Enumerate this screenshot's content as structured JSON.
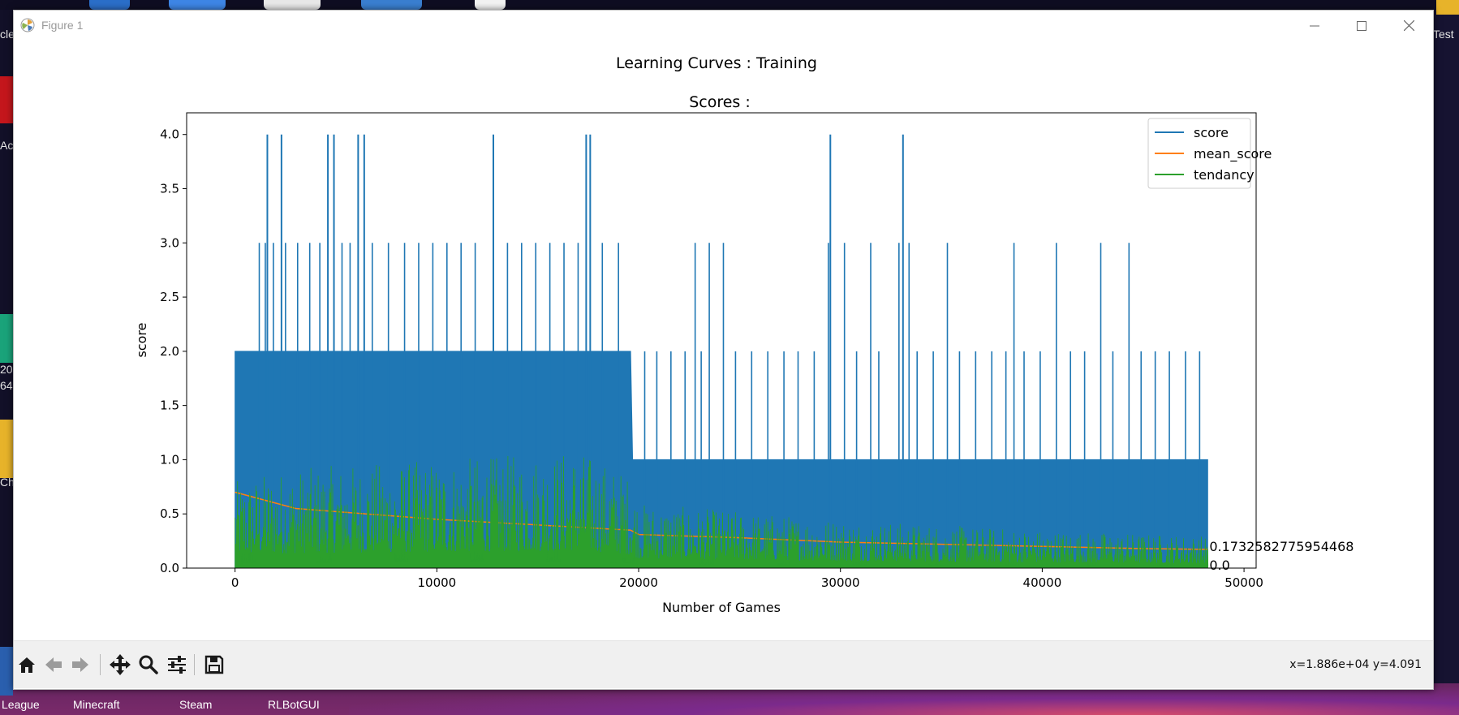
{
  "window": {
    "title": "Figure 1",
    "controls": {
      "minimize": "minimize",
      "maximize": "maximize",
      "close": "close"
    }
  },
  "figure": {
    "suptitle": "Learning Curves : Training",
    "subplot_title": "Scores :"
  },
  "chart_data": {
    "type": "line",
    "title": "Scores :",
    "xlabel": "Number of Games",
    "ylabel": "score",
    "xlim": [
      -2400,
      50600
    ],
    "ylim": [
      0,
      4.2
    ],
    "xticks": [
      0,
      10000,
      20000,
      30000,
      40000,
      50000
    ],
    "xtick_labels": [
      "0",
      "10000",
      "20000",
      "30000",
      "40000",
      "50000"
    ],
    "yticks": [
      0.0,
      0.5,
      1.0,
      1.5,
      2.0,
      2.5,
      3.0,
      3.5,
      4.0
    ],
    "ytick_labels": [
      "0.0",
      "0.5",
      "1.0",
      "1.5",
      "2.0",
      "2.5",
      "3.0",
      "3.5",
      "4.0"
    ],
    "legend_position": "upper right",
    "grid": false,
    "series": [
      {
        "name": "score",
        "color": "#1f77b4",
        "x_range": [
          0,
          48200
        ],
        "baseline_max": [
          [
            0,
            2
          ],
          [
            19600,
            2
          ],
          [
            19700,
            1
          ],
          [
            48200,
            1
          ]
        ],
        "spikes_to_4": [
          1600,
          2300,
          4600,
          4900,
          6100,
          6400,
          12800,
          17400,
          17600,
          29500,
          33100
        ],
        "spikes_to_3": [
          1200,
          1500,
          1900,
          2500,
          3100,
          3700,
          4200,
          5300,
          5700,
          6800,
          7600,
          8400,
          9100,
          9800,
          10500,
          11200,
          11900,
          13500,
          14200,
          14900,
          15600,
          16300,
          17000,
          18200,
          19000,
          22800,
          23500,
          24200,
          29400,
          30200,
          31500,
          32900,
          33400,
          35300,
          38600,
          40700,
          42900,
          44300
        ],
        "spikes_to_2_after_20000": [
          20300,
          20900,
          21600,
          22300,
          23100,
          24800,
          25600,
          26400,
          27200,
          27900,
          28700,
          30800,
          31900,
          33800,
          34600,
          35900,
          36700,
          37500,
          38200,
          39100,
          39900,
          41400,
          42100,
          43500,
          44900,
          45600,
          46300,
          47100,
          47800
        ]
      },
      {
        "name": "mean_score",
        "color": "#ff7f0e",
        "points": [
          [
            0,
            0.7
          ],
          [
            3000,
            0.55
          ],
          [
            10000,
            0.45
          ],
          [
            19600,
            0.35
          ],
          [
            20000,
            0.31
          ],
          [
            25000,
            0.28
          ],
          [
            30000,
            0.24
          ],
          [
            35000,
            0.22
          ],
          [
            40000,
            0.2
          ],
          [
            45000,
            0.18
          ],
          [
            48200,
            0.173
          ]
        ]
      },
      {
        "name": "tendancy",
        "color": "#2ca02c",
        "envelope": [
          [
            0,
            0.8
          ],
          [
            2000,
            0.9
          ],
          [
            5000,
            0.95
          ],
          [
            10000,
            1.0
          ],
          [
            14000,
            1.05
          ],
          [
            17000,
            1.1
          ],
          [
            19600,
            0.85
          ],
          [
            20000,
            0.6
          ],
          [
            30000,
            0.45
          ],
          [
            40000,
            0.35
          ],
          [
            48200,
            0.3
          ]
        ]
      }
    ],
    "annotations": [
      {
        "text": "0.1732582775954468",
        "x": 48200,
        "y": 0.173
      },
      {
        "text": "0.0",
        "x": 48200,
        "y": 0.0
      }
    ]
  },
  "toolbar": {
    "buttons": [
      "home",
      "back",
      "forward",
      "pan",
      "zoom",
      "configure-subplots",
      "save"
    ],
    "coords_text": "x=1.886e+04 y=4.091"
  },
  "desktop": {
    "left_labels": [
      "cle",
      "Ac",
      "20",
      "64",
      "Ch"
    ],
    "right_label": "Test",
    "taskbar_labels": [
      "League",
      "Minecraft",
      "Steam",
      "RLBotGUI"
    ]
  }
}
